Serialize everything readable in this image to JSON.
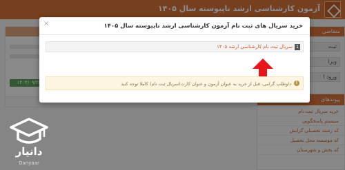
{
  "page": {
    "header_title": "آزمون کارشناسی ارشد ناپیوسته سال ۱۴۰۵",
    "date_badge": "۱۴۰۴/۰۹/۲۳",
    "date_prefix": "ع",
    "right_panel": {
      "title": "متقاضی",
      "buttons": [
        "ثبت",
        "ویرا",
        "ورود ا"
      ]
    },
    "links_panel": {
      "title": "پیوندهای",
      "items": [
        "خرید سریال ثبت نام",
        "سیستم پاسخگویی",
        "کد رشته تحصیلی گرایش",
        "کد موسسه محل تحصیل",
        "کد بخش و شهرستان"
      ]
    }
  },
  "modal": {
    "title": "خرید سریال های ثبت نام آزمون کارشناسی ارشد ناپیوسته سال ۱۴۰۵",
    "close_symbol": "×",
    "link_number": "1",
    "link_text": "سریال ثبت نام کارشناسی ارشد ۱۴۰۵",
    "notice_icon": "!",
    "notice_text": "داوطلب گرامی، قبل از خرید به عنوان آزمون و عنوان کارت(سریال ثبت نام) کاملا توجه کنید"
  },
  "brand": {
    "name": "دانیار",
    "sub": "Danyaar"
  },
  "colors": {
    "accent": "#d8743a",
    "arrow": "#e8161b",
    "link": "#d0532a"
  },
  "icons": [
    "close-icon",
    "info-icon",
    "red-arrow-icon",
    "graduation-cap-icon"
  ]
}
